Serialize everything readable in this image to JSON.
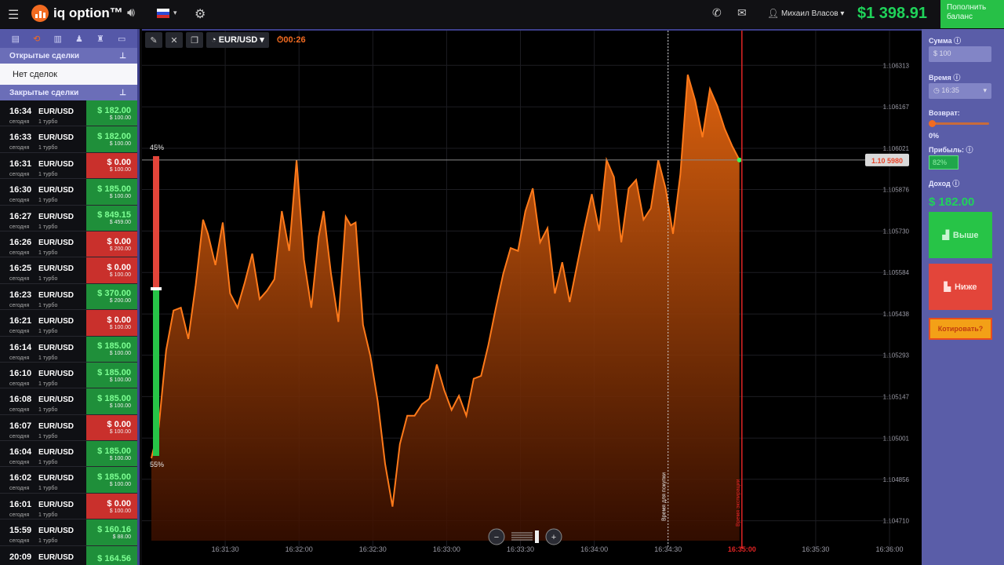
{
  "topbar": {
    "brand": "iq option™",
    "user_name": "Михаил Власов",
    "balance": "$1 398.91",
    "deposit_label": "Пополнить баланс"
  },
  "left_panel": {
    "open_deals_header": "Открытые сделки",
    "no_deals_text": "Нет сделок",
    "closed_deals_header": "Закрытые сделки",
    "deals": [
      {
        "time": "16:34",
        "pair": "EUR/USD",
        "day": "сегодня",
        "type": "1 турбо",
        "result": "$ 182.00",
        "stake": "$ 100.00",
        "win": true
      },
      {
        "time": "16:33",
        "pair": "EUR/USD",
        "day": "сегодня",
        "type": "1 турбо",
        "result": "$ 182.00",
        "stake": "$ 100.00",
        "win": true
      },
      {
        "time": "16:31",
        "pair": "EUR/USD",
        "day": "сегодня",
        "type": "1 турбо",
        "result": "$ 0.00",
        "stake": "$ 100.00",
        "win": false
      },
      {
        "time": "16:30",
        "pair": "EUR/USD",
        "day": "сегодня",
        "type": "1 турбо",
        "result": "$ 185.00",
        "stake": "$ 100.00",
        "win": true
      },
      {
        "time": "16:27",
        "pair": "EUR/USD",
        "day": "сегодня",
        "type": "1 турбо",
        "result": "$ 849.15",
        "stake": "$ 459.00",
        "win": true
      },
      {
        "time": "16:26",
        "pair": "EUR/USD",
        "day": "сегодня",
        "type": "1 турбо",
        "result": "$ 0.00",
        "stake": "$ 200.00",
        "win": false
      },
      {
        "time": "16:25",
        "pair": "EUR/USD",
        "day": "сегодня",
        "type": "1 турбо",
        "result": "$ 0.00",
        "stake": "$ 100.00",
        "win": false
      },
      {
        "time": "16:23",
        "pair": "EUR/USD",
        "day": "сегодня",
        "type": "1 турбо",
        "result": "$ 370.00",
        "stake": "$ 200.00",
        "win": true
      },
      {
        "time": "16:21",
        "pair": "EUR/USD",
        "day": "сегодня",
        "type": "1 турбо",
        "result": "$ 0.00",
        "stake": "$ 100.00",
        "win": false
      },
      {
        "time": "16:14",
        "pair": "EUR/USD",
        "day": "сегодня",
        "type": "1 турбо",
        "result": "$ 185.00",
        "stake": "$ 100.00",
        "win": true
      },
      {
        "time": "16:10",
        "pair": "EUR/USD",
        "day": "сегодня",
        "type": "1 турбо",
        "result": "$ 185.00",
        "stake": "$ 100.00",
        "win": true
      },
      {
        "time": "16:08",
        "pair": "EUR/USD",
        "day": "сегодня",
        "type": "1 турбо",
        "result": "$ 185.00",
        "stake": "$ 100.00",
        "win": true
      },
      {
        "time": "16:07",
        "pair": "EUR/USD",
        "day": "сегодня",
        "type": "1 турбо",
        "result": "$ 0.00",
        "stake": "$ 100.00",
        "win": false
      },
      {
        "time": "16:04",
        "pair": "EUR/USD",
        "day": "сегодня",
        "type": "1 турбо",
        "result": "$ 185.00",
        "stake": "$ 100.00",
        "win": true
      },
      {
        "time": "16:02",
        "pair": "EUR/USD",
        "day": "сегодня",
        "type": "1 турбо",
        "result": "$ 185.00",
        "stake": "$ 100.00",
        "win": true
      },
      {
        "time": "16:01",
        "pair": "EUR/USD",
        "day": "сегодня",
        "type": "1 турбо",
        "result": "$ 0.00",
        "stake": "$ 100.00",
        "win": false
      },
      {
        "time": "15:59",
        "pair": "EUR/USD",
        "day": "сегодня",
        "type": "1 турбо",
        "result": "$ 160.16",
        "stake": "$ 88.00",
        "win": true
      },
      {
        "time": "20:09",
        "pair": "EUR/USD (O...",
        "day": "",
        "type": "",
        "result": "$ 164.56",
        "stake": "",
        "win": true
      }
    ]
  },
  "chart_toolbar": {
    "pair": "EUR/USD",
    "timer": "00:26"
  },
  "chart": {
    "pct_top": "45%",
    "pct_bottom": "55%",
    "current_price_tag": "1.10 5980",
    "purchase_time_label": "Время для покупки",
    "expiry_time_label": "Время экспирации",
    "colors": {
      "line": "#ff7a1a",
      "fill_top": "#e8670f",
      "fill_bottom": "#3a0f00",
      "expiry": "#e02424",
      "up": "#27c447",
      "down": "#e3453a"
    }
  },
  "chart_data": {
    "type": "area",
    "ylim": [
      1.10464,
      1.10638
    ],
    "y_ticks": [
      "1.106313",
      "1.106167",
      "1.106021",
      "1.105876",
      "1.105730",
      "1.105584",
      "1.105438",
      "1.105293",
      "1.105147",
      "1.105001",
      "1.104856",
      "1.104710"
    ],
    "y_tick_values": [
      1.106313,
      1.106167,
      1.106021,
      1.105876,
      1.10573,
      1.105584,
      1.105438,
      1.105293,
      1.105147,
      1.105001,
      1.104856,
      1.10471
    ],
    "x_ticks": [
      "16:31:30",
      "16:32:00",
      "16:32:30",
      "16:33:00",
      "16:33:30",
      "16:34:00",
      "16:34:30",
      "16:35:00",
      "16:35:30",
      "16:36:00"
    ],
    "x_start_sec": 60660,
    "x_end_sec": 60967,
    "expiry_sec": 60900,
    "purchase_sec": 60870,
    "current_price": 1.10598,
    "series": [
      {
        "values": [
          [
            60660,
            1.10493
          ],
          [
            60663,
            1.10504
          ],
          [
            60666,
            1.10531
          ],
          [
            60669,
            1.10545
          ],
          [
            60672,
            1.10546
          ],
          [
            60675,
            1.10535
          ],
          [
            60678,
            1.10554
          ],
          [
            60681,
            1.10577
          ],
          [
            60683,
            1.10572
          ],
          [
            60686,
            1.10561
          ],
          [
            60689,
            1.10576
          ],
          [
            60692,
            1.10551
          ],
          [
            60695,
            1.10546
          ],
          [
            60698,
            1.10555
          ],
          [
            60701,
            1.10565
          ],
          [
            60704,
            1.10549
          ],
          [
            60707,
            1.10552
          ],
          [
            60710,
            1.10556
          ],
          [
            60713,
            1.1058
          ],
          [
            60716,
            1.10566
          ],
          [
            60719,
            1.10598
          ],
          [
            60722,
            1.10563
          ],
          [
            60725,
            1.10546
          ],
          [
            60728,
            1.10571
          ],
          [
            60730,
            1.1058
          ],
          [
            60733,
            1.10558
          ],
          [
            60736,
            1.10541
          ],
          [
            60739,
            1.10578
          ],
          [
            60741,
            1.10575
          ],
          [
            60743,
            1.10576
          ],
          [
            60746,
            1.1054
          ],
          [
            60749,
            1.10529
          ],
          [
            60752,
            1.10513
          ],
          [
            60755,
            1.10491
          ],
          [
            60758,
            1.10476
          ],
          [
            60761,
            1.10498
          ],
          [
            60764,
            1.10508
          ],
          [
            60767,
            1.10508
          ],
          [
            60770,
            1.10512
          ],
          [
            60773,
            1.10514
          ],
          [
            60776,
            1.10526
          ],
          [
            60779,
            1.10517
          ],
          [
            60782,
            1.1051
          ],
          [
            60785,
            1.10515
          ],
          [
            60788,
            1.10508
          ],
          [
            60791,
            1.10521
          ],
          [
            60794,
            1.10522
          ],
          [
            60797,
            1.10533
          ],
          [
            60800,
            1.10546
          ],
          [
            60803,
            1.10558
          ],
          [
            60806,
            1.10567
          ],
          [
            60809,
            1.10566
          ],
          [
            60812,
            1.1058
          ],
          [
            60815,
            1.10588
          ],
          [
            60818,
            1.10569
          ],
          [
            60821,
            1.10574
          ],
          [
            60824,
            1.10551
          ],
          [
            60827,
            1.10562
          ],
          [
            60830,
            1.10548
          ],
          [
            60833,
            1.10561
          ],
          [
            60836,
            1.10574
          ],
          [
            60839,
            1.10586
          ],
          [
            60842,
            1.10573
          ],
          [
            60845,
            1.10598
          ],
          [
            60848,
            1.10592
          ],
          [
            60851,
            1.10569
          ],
          [
            60854,
            1.10588
          ],
          [
            60857,
            1.10591
          ],
          [
            60860,
            1.10577
          ],
          [
            60863,
            1.10581
          ],
          [
            60866,
            1.10598
          ],
          [
            60869,
            1.10588
          ],
          [
            60872,
            1.10572
          ],
          [
            60875,
            1.10593
          ],
          [
            60878,
            1.10628
          ],
          [
            60881,
            1.10619
          ],
          [
            60884,
            1.10606
          ],
          [
            60887,
            1.10623
          ],
          [
            60890,
            1.10617
          ],
          [
            60893,
            1.10609
          ],
          [
            60896,
            1.10603
          ],
          [
            60899,
            1.10598
          ]
        ]
      }
    ]
  },
  "chart_footer": {
    "zoom_out": "−",
    "zoom_in": "+"
  },
  "right_panel": {
    "amount_label": "Сумма",
    "amount_value": "$ 100",
    "time_label": "Время",
    "time_value": "16:35",
    "return_label": "Возврат:",
    "return_value": "0%",
    "profit_label": "Прибыль:",
    "profit_value": "82%",
    "income_label": "Доход",
    "income_value": "$ 182.00",
    "higher_label": "Выше",
    "lower_label": "Ниже",
    "sell_label": "Котировать?"
  }
}
